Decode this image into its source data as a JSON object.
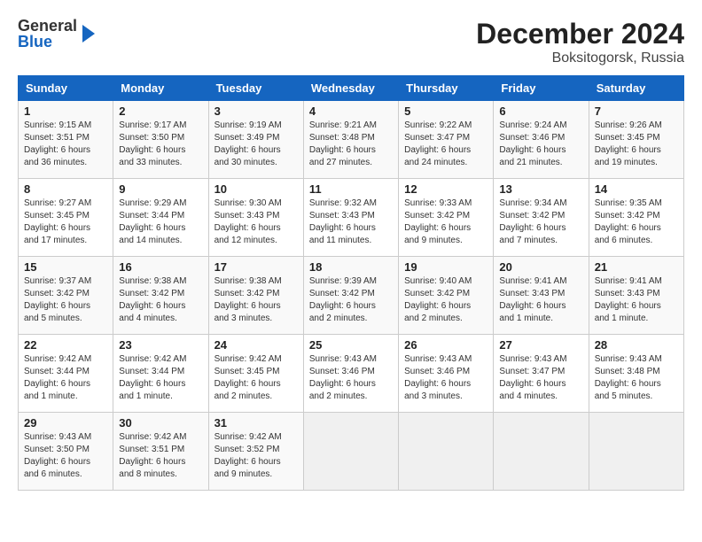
{
  "logo": {
    "general": "General",
    "blue": "Blue"
  },
  "header": {
    "month_year": "December 2024",
    "location": "Boksitogorsk, Russia"
  },
  "weekdays": [
    "Sunday",
    "Monday",
    "Tuesday",
    "Wednesday",
    "Thursday",
    "Friday",
    "Saturday"
  ],
  "weeks": [
    [
      {
        "day": "1",
        "sunrise": "9:15 AM",
        "sunset": "3:51 PM",
        "daylight": "6 hours and 36 minutes."
      },
      {
        "day": "2",
        "sunrise": "9:17 AM",
        "sunset": "3:50 PM",
        "daylight": "6 hours and 33 minutes."
      },
      {
        "day": "3",
        "sunrise": "9:19 AM",
        "sunset": "3:49 PM",
        "daylight": "6 hours and 30 minutes."
      },
      {
        "day": "4",
        "sunrise": "9:21 AM",
        "sunset": "3:48 PM",
        "daylight": "6 hours and 27 minutes."
      },
      {
        "day": "5",
        "sunrise": "9:22 AM",
        "sunset": "3:47 PM",
        "daylight": "6 hours and 24 minutes."
      },
      {
        "day": "6",
        "sunrise": "9:24 AM",
        "sunset": "3:46 PM",
        "daylight": "6 hours and 21 minutes."
      },
      {
        "day": "7",
        "sunrise": "9:26 AM",
        "sunset": "3:45 PM",
        "daylight": "6 hours and 19 minutes."
      }
    ],
    [
      {
        "day": "8",
        "sunrise": "9:27 AM",
        "sunset": "3:45 PM",
        "daylight": "6 hours and 17 minutes."
      },
      {
        "day": "9",
        "sunrise": "9:29 AM",
        "sunset": "3:44 PM",
        "daylight": "6 hours and 14 minutes."
      },
      {
        "day": "10",
        "sunrise": "9:30 AM",
        "sunset": "3:43 PM",
        "daylight": "6 hours and 12 minutes."
      },
      {
        "day": "11",
        "sunrise": "9:32 AM",
        "sunset": "3:43 PM",
        "daylight": "6 hours and 11 minutes."
      },
      {
        "day": "12",
        "sunrise": "9:33 AM",
        "sunset": "3:42 PM",
        "daylight": "6 hours and 9 minutes."
      },
      {
        "day": "13",
        "sunrise": "9:34 AM",
        "sunset": "3:42 PM",
        "daylight": "6 hours and 7 minutes."
      },
      {
        "day": "14",
        "sunrise": "9:35 AM",
        "sunset": "3:42 PM",
        "daylight": "6 hours and 6 minutes."
      }
    ],
    [
      {
        "day": "15",
        "sunrise": "9:37 AM",
        "sunset": "3:42 PM",
        "daylight": "6 hours and 5 minutes."
      },
      {
        "day": "16",
        "sunrise": "9:38 AM",
        "sunset": "3:42 PM",
        "daylight": "6 hours and 4 minutes."
      },
      {
        "day": "17",
        "sunrise": "9:38 AM",
        "sunset": "3:42 PM",
        "daylight": "6 hours and 3 minutes."
      },
      {
        "day": "18",
        "sunrise": "9:39 AM",
        "sunset": "3:42 PM",
        "daylight": "6 hours and 2 minutes."
      },
      {
        "day": "19",
        "sunrise": "9:40 AM",
        "sunset": "3:42 PM",
        "daylight": "6 hours and 2 minutes."
      },
      {
        "day": "20",
        "sunrise": "9:41 AM",
        "sunset": "3:43 PM",
        "daylight": "6 hours and 1 minute."
      },
      {
        "day": "21",
        "sunrise": "9:41 AM",
        "sunset": "3:43 PM",
        "daylight": "6 hours and 1 minute."
      }
    ],
    [
      {
        "day": "22",
        "sunrise": "9:42 AM",
        "sunset": "3:44 PM",
        "daylight": "6 hours and 1 minute."
      },
      {
        "day": "23",
        "sunrise": "9:42 AM",
        "sunset": "3:44 PM",
        "daylight": "6 hours and 1 minute."
      },
      {
        "day": "24",
        "sunrise": "9:42 AM",
        "sunset": "3:45 PM",
        "daylight": "6 hours and 2 minutes."
      },
      {
        "day": "25",
        "sunrise": "9:43 AM",
        "sunset": "3:46 PM",
        "daylight": "6 hours and 2 minutes."
      },
      {
        "day": "26",
        "sunrise": "9:43 AM",
        "sunset": "3:46 PM",
        "daylight": "6 hours and 3 minutes."
      },
      {
        "day": "27",
        "sunrise": "9:43 AM",
        "sunset": "3:47 PM",
        "daylight": "6 hours and 4 minutes."
      },
      {
        "day": "28",
        "sunrise": "9:43 AM",
        "sunset": "3:48 PM",
        "daylight": "6 hours and 5 minutes."
      }
    ],
    [
      {
        "day": "29",
        "sunrise": "9:43 AM",
        "sunset": "3:50 PM",
        "daylight": "6 hours and 6 minutes."
      },
      {
        "day": "30",
        "sunrise": "9:42 AM",
        "sunset": "3:51 PM",
        "daylight": "6 hours and 8 minutes."
      },
      {
        "day": "31",
        "sunrise": "9:42 AM",
        "sunset": "3:52 PM",
        "daylight": "6 hours and 9 minutes."
      },
      null,
      null,
      null,
      null
    ]
  ]
}
